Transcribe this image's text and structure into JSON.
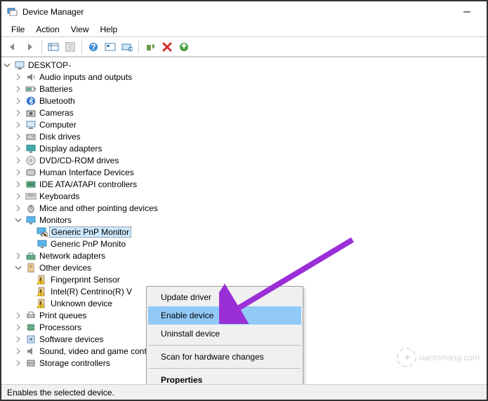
{
  "titlebar": {
    "title": "Device Manager"
  },
  "menubar": {
    "file": "File",
    "action": "Action",
    "view": "View",
    "help": "Help"
  },
  "tree": {
    "root": "DESKTOP-",
    "items": [
      "Audio inputs and outputs",
      "Batteries",
      "Bluetooth",
      "Cameras",
      "Computer",
      "Disk drives",
      "Display adapters",
      "DVD/CD-ROM drives",
      "Human Interface Devices",
      "IDE ATA/ATAPI controllers",
      "Keyboards",
      "Mice and other pointing devices"
    ],
    "monitors": {
      "label": "Monitors",
      "children": [
        "Generic PnP Monitor",
        "Generic PnP Monito"
      ]
    },
    "network": "Network adapters",
    "other": {
      "label": "Other devices",
      "children": [
        "Fingerprint Sensor",
        "Intel(R) Centrino(R) V",
        "Unknown device"
      ]
    },
    "after": [
      "Print queues",
      "Processors",
      "Software devices",
      "Sound, video and game controllers",
      "Storage controllers"
    ]
  },
  "contextmenu": {
    "update": "Update driver",
    "enable": "Enable device",
    "uninstall": "Uninstall device",
    "scan": "Scan for hardware changes",
    "properties": "Properties"
  },
  "statusbar": {
    "text": "Enables the selected device."
  },
  "watermark": {
    "text": "uantrimang.com"
  }
}
